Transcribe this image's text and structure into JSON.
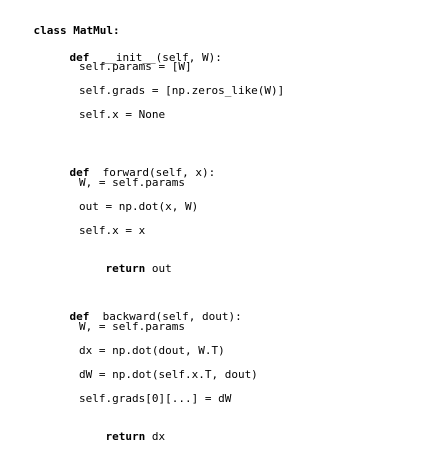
{
  "class_header": {
    "keyword": "class",
    "name": "MatMul:"
  },
  "methods": [
    {
      "keyword": "def",
      "signature": "__init__(self, W):",
      "body": [
        "self.params = [W]",
        "self.grads = [np.zeros_like(W)]",
        "self.x = None"
      ]
    },
    {
      "keyword": "def",
      "signature": "forward(self, x):",
      "body": [
        "W, = self.params",
        "out = np.dot(x, W)",
        "self.x = x",
        "return out"
      ],
      "return_keyword_line": 3
    },
    {
      "keyword": "def",
      "signature": "backward(self, dout):",
      "body": [
        "W, = self.params",
        "dx = np.dot(dout, W.T)",
        "dW = np.dot(self.x.T, dout)",
        "self.grads[0][...] = dW",
        "return dx"
      ],
      "return_keyword_line": 4
    }
  ],
  "return_keyword": "return",
  "return_values": {
    "forward": "out",
    "backward": "dx"
  }
}
